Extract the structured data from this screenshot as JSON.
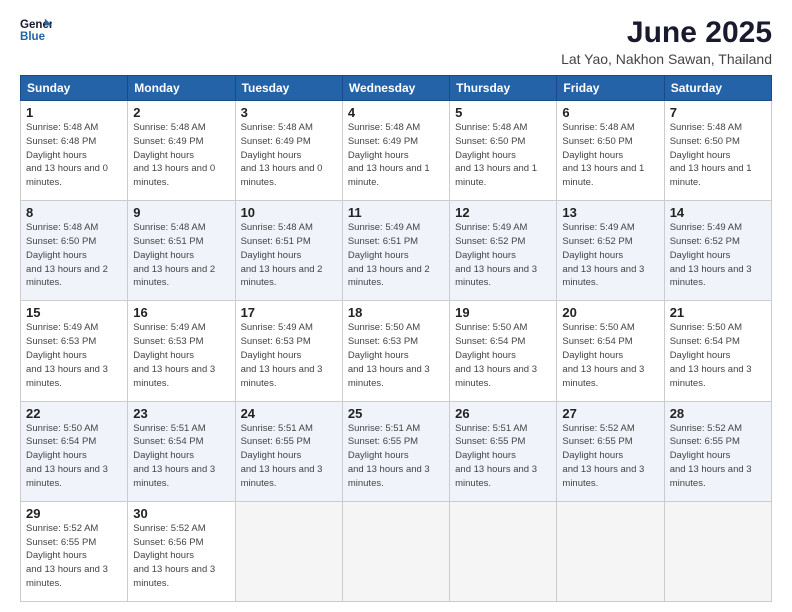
{
  "logo": {
    "line1": "General",
    "line2": "Blue"
  },
  "title": "June 2025",
  "subtitle": "Lat Yao, Nakhon Sawan, Thailand",
  "headers": [
    "Sunday",
    "Monday",
    "Tuesday",
    "Wednesday",
    "Thursday",
    "Friday",
    "Saturday"
  ],
  "weeks": [
    [
      {
        "day": "1",
        "rise": "5:48 AM",
        "set": "6:48 PM",
        "hours": "13 hours and 0 minutes."
      },
      {
        "day": "2",
        "rise": "5:48 AM",
        "set": "6:49 PM",
        "hours": "13 hours and 0 minutes."
      },
      {
        "day": "3",
        "rise": "5:48 AM",
        "set": "6:49 PM",
        "hours": "13 hours and 0 minutes."
      },
      {
        "day": "4",
        "rise": "5:48 AM",
        "set": "6:49 PM",
        "hours": "13 hours and 1 minute."
      },
      {
        "day": "5",
        "rise": "5:48 AM",
        "set": "6:50 PM",
        "hours": "13 hours and 1 minute."
      },
      {
        "day": "6",
        "rise": "5:48 AM",
        "set": "6:50 PM",
        "hours": "13 hours and 1 minute."
      },
      {
        "day": "7",
        "rise": "5:48 AM",
        "set": "6:50 PM",
        "hours": "13 hours and 1 minute."
      }
    ],
    [
      {
        "day": "8",
        "rise": "5:48 AM",
        "set": "6:50 PM",
        "hours": "13 hours and 2 minutes."
      },
      {
        "day": "9",
        "rise": "5:48 AM",
        "set": "6:51 PM",
        "hours": "13 hours and 2 minutes."
      },
      {
        "day": "10",
        "rise": "5:48 AM",
        "set": "6:51 PM",
        "hours": "13 hours and 2 minutes."
      },
      {
        "day": "11",
        "rise": "5:49 AM",
        "set": "6:51 PM",
        "hours": "13 hours and 2 minutes."
      },
      {
        "day": "12",
        "rise": "5:49 AM",
        "set": "6:52 PM",
        "hours": "13 hours and 3 minutes."
      },
      {
        "day": "13",
        "rise": "5:49 AM",
        "set": "6:52 PM",
        "hours": "13 hours and 3 minutes."
      },
      {
        "day": "14",
        "rise": "5:49 AM",
        "set": "6:52 PM",
        "hours": "13 hours and 3 minutes."
      }
    ],
    [
      {
        "day": "15",
        "rise": "5:49 AM",
        "set": "6:53 PM",
        "hours": "13 hours and 3 minutes."
      },
      {
        "day": "16",
        "rise": "5:49 AM",
        "set": "6:53 PM",
        "hours": "13 hours and 3 minutes."
      },
      {
        "day": "17",
        "rise": "5:49 AM",
        "set": "6:53 PM",
        "hours": "13 hours and 3 minutes."
      },
      {
        "day": "18",
        "rise": "5:50 AM",
        "set": "6:53 PM",
        "hours": "13 hours and 3 minutes."
      },
      {
        "day": "19",
        "rise": "5:50 AM",
        "set": "6:54 PM",
        "hours": "13 hours and 3 minutes."
      },
      {
        "day": "20",
        "rise": "5:50 AM",
        "set": "6:54 PM",
        "hours": "13 hours and 3 minutes."
      },
      {
        "day": "21",
        "rise": "5:50 AM",
        "set": "6:54 PM",
        "hours": "13 hours and 3 minutes."
      }
    ],
    [
      {
        "day": "22",
        "rise": "5:50 AM",
        "set": "6:54 PM",
        "hours": "13 hours and 3 minutes."
      },
      {
        "day": "23",
        "rise": "5:51 AM",
        "set": "6:54 PM",
        "hours": "13 hours and 3 minutes."
      },
      {
        "day": "24",
        "rise": "5:51 AM",
        "set": "6:55 PM",
        "hours": "13 hours and 3 minutes."
      },
      {
        "day": "25",
        "rise": "5:51 AM",
        "set": "6:55 PM",
        "hours": "13 hours and 3 minutes."
      },
      {
        "day": "26",
        "rise": "5:51 AM",
        "set": "6:55 PM",
        "hours": "13 hours and 3 minutes."
      },
      {
        "day": "27",
        "rise": "5:52 AM",
        "set": "6:55 PM",
        "hours": "13 hours and 3 minutes."
      },
      {
        "day": "28",
        "rise": "5:52 AM",
        "set": "6:55 PM",
        "hours": "13 hours and 3 minutes."
      }
    ],
    [
      {
        "day": "29",
        "rise": "5:52 AM",
        "set": "6:55 PM",
        "hours": "13 hours and 3 minutes."
      },
      {
        "day": "30",
        "rise": "5:52 AM",
        "set": "6:56 PM",
        "hours": "13 hours and 3 minutes."
      },
      null,
      null,
      null,
      null,
      null
    ]
  ]
}
